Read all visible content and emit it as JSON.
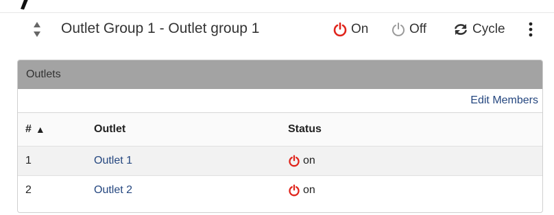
{
  "header": {
    "title": "Outlet Group 1 - Outlet group 1",
    "actions": [
      {
        "label": "On",
        "icon": "power-icon",
        "color": "#e0241b"
      },
      {
        "label": "Off",
        "icon": "power-icon",
        "color": "#9a9a9a"
      },
      {
        "label": "Cycle",
        "icon": "refresh-icon",
        "color": "#333333"
      }
    ],
    "more_icon": "kebab-menu-icon",
    "reorder_icon": "sort-handle-icon"
  },
  "panel": {
    "title": "Outlets",
    "edit_members_label": "Edit Members",
    "columns": {
      "number": "#",
      "number_sort_indicator": "▲",
      "outlet": "Outlet",
      "status": "Status"
    },
    "rows": [
      {
        "number": "1",
        "outlet": "Outlet 1",
        "status": "on"
      },
      {
        "number": "2",
        "outlet": "Outlet 2",
        "status": "on"
      }
    ]
  },
  "colors": {
    "power_on": "#e0241b",
    "power_off": "#9a9a9a",
    "link": "#24467f",
    "panel_header_bg": "#a3a3a3"
  }
}
